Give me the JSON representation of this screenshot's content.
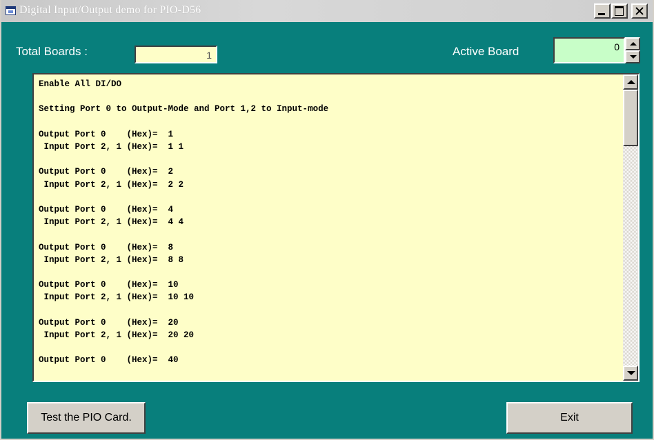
{
  "window": {
    "title": "Digital Input/Output demo for PIO-D56",
    "icons": [
      "app-window-icon",
      "minimize-icon",
      "maximize-icon",
      "close-icon"
    ]
  },
  "header": {
    "total_boards_label": "Total Boards :",
    "total_boards_value": "1",
    "active_board_label": "Active Board",
    "active_board_value": "0"
  },
  "log": {
    "lines": [
      "Enable All DI/DO",
      "",
      "Setting Port 0 to Output-Mode and Port 1,2 to Input-mode",
      "",
      "Output Port 0    (Hex)=  1",
      " Input Port 2, 1 (Hex)=  1 1",
      "",
      "Output Port 0    (Hex)=  2",
      " Input Port 2, 1 (Hex)=  2 2",
      "",
      "Output Port 0    (Hex)=  4",
      " Input Port 2, 1 (Hex)=  4 4",
      "",
      "Output Port 0    (Hex)=  8",
      " Input Port 2, 1 (Hex)=  8 8",
      "",
      "Output Port 0    (Hex)=  10",
      " Input Port 2, 1 (Hex)=  10 10",
      "",
      "Output Port 0    (Hex)=  20",
      " Input Port 2, 1 (Hex)=  20 20",
      "",
      "Output Port 0    (Hex)=  40"
    ]
  },
  "buttons": {
    "test_label": "Test the PIO Card.",
    "exit_label": "Exit"
  },
  "colors": {
    "window_bg": "#087f7c",
    "textbox_bg": "#fefec8",
    "active_input_bg": "#c8fec8",
    "button_face": "#d4d0c8"
  }
}
